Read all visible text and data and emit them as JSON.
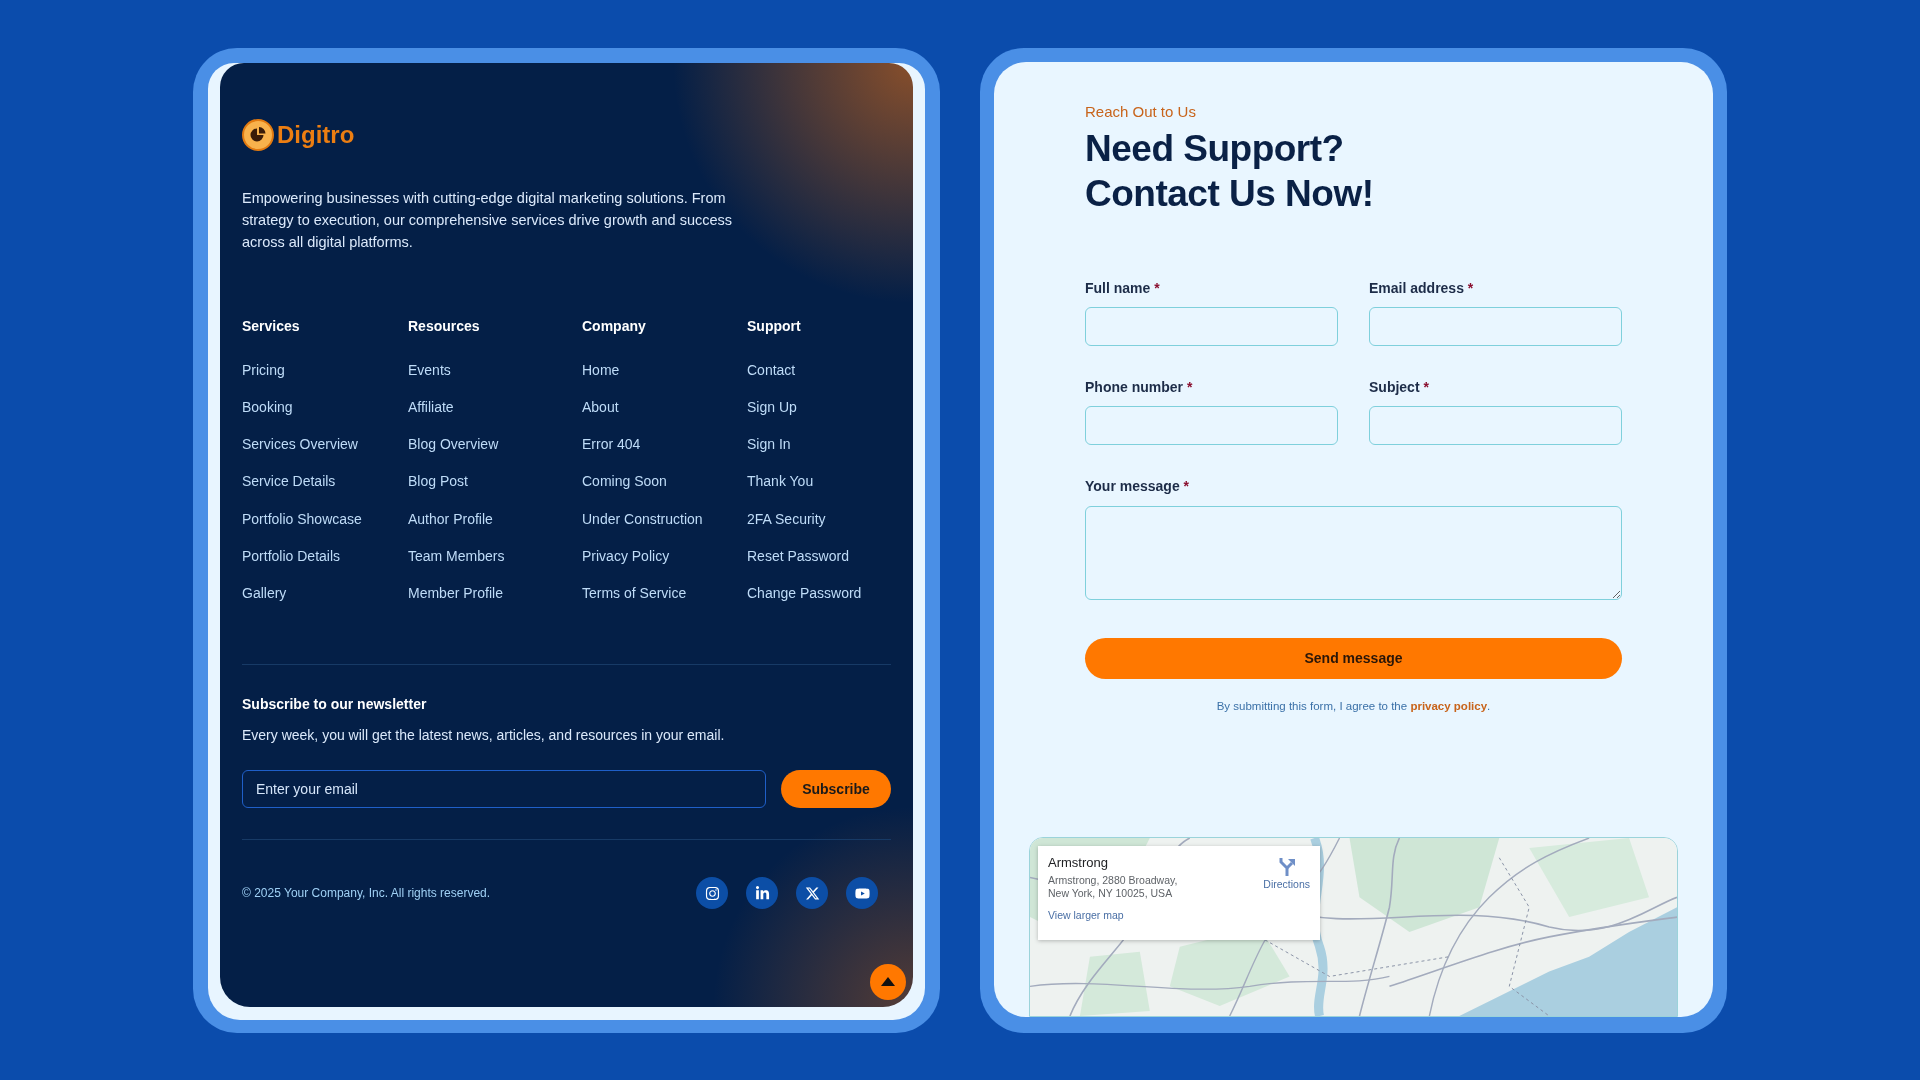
{
  "footer": {
    "brand": "Digitro",
    "description": "Empowering businesses with cutting-edge digital marketing solutions. From strategy to execution, our comprehensive services drive growth and success across all digital platforms.",
    "link_columns": [
      {
        "heading": "Services",
        "links": [
          "Pricing",
          "Booking",
          "Services Overview",
          "Service Details",
          "Portfolio Showcase",
          "Portfolio Details",
          "Gallery"
        ]
      },
      {
        "heading": "Resources",
        "links": [
          "Events",
          "Affiliate",
          "Blog Overview",
          "Blog Post",
          "Author Profile",
          "Team Members",
          "Member Profile"
        ]
      },
      {
        "heading": "Company",
        "links": [
          "Home",
          "About",
          "Error 404",
          "Coming Soon",
          "Under Construction",
          "Privacy Policy",
          "Terms of Service"
        ]
      },
      {
        "heading": "Support",
        "links": [
          "Contact",
          "Sign Up",
          "Sign In",
          "Thank You",
          "2FA Security",
          "Reset Password",
          "Change Password"
        ]
      }
    ],
    "newsletter": {
      "heading": "Subscribe to our newsletter",
      "text": "Every week, you will get the latest news, articles, and resources in your email.",
      "email_field": {
        "placeholder": "Enter your email"
      },
      "button": "Subscribe"
    },
    "copyright": "© 2025 Your Company, Inc. All rights reserved.",
    "social_links": [
      {
        "kind": "instagram"
      },
      {
        "kind": "linkedin"
      },
      {
        "kind": "x"
      },
      {
        "kind": "youtube"
      }
    ]
  },
  "contact": {
    "eyebrow": "Reach Out to Us",
    "heading_lines": [
      "Need Support?",
      "Contact Us Now!"
    ],
    "fields": [
      {
        "label": "Full name",
        "mark": "*",
        "kind": "input"
      },
      {
        "label": "Email address",
        "mark": "*",
        "kind": "input"
      },
      {
        "label": "Phone number",
        "mark": "*",
        "kind": "input"
      },
      {
        "label": "Subject",
        "mark": "*",
        "kind": "input"
      },
      {
        "label": "Your message",
        "mark": "*",
        "kind": "textarea"
      }
    ],
    "submit_button": "Send message",
    "consent": {
      "before": "By submitting this form, I agree to the",
      "link": "privacy policy",
      "after": "."
    },
    "map": {
      "place_card": {
        "name": "Armstrong",
        "address": "Armstrong, 2880 Broadway, New York, NY 10025, USA",
        "directions": "Directions",
        "larger_map_link": "View larger map"
      }
    }
  }
}
